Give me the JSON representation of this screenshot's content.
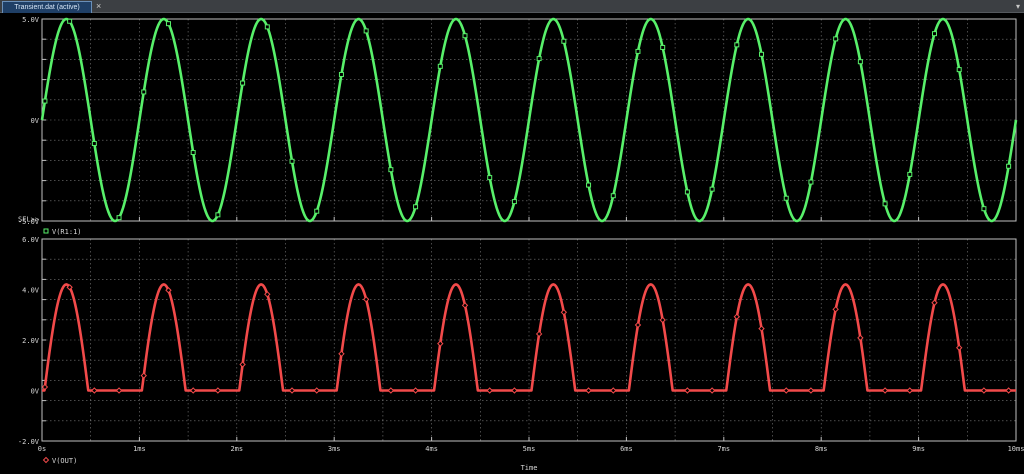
{
  "tab": {
    "label": "Transient.dat (active)",
    "close_glyph": "×",
    "menu_glyph": "▾"
  },
  "colors": {
    "plot_bg": "#000000",
    "grid": "#7a7a7a",
    "axis": "#bfbfbf",
    "series1": "#58f06a",
    "series2": "#f24a4a"
  },
  "x_axis": {
    "title": "Time",
    "ticks": [
      "0s",
      "1ms",
      "2ms",
      "3ms",
      "4ms",
      "5ms",
      "6ms",
      "7ms",
      "8ms",
      "9ms",
      "10ms"
    ]
  },
  "sel_marker": "SEL>>",
  "chart_data": [
    {
      "type": "line",
      "series": [
        {
          "name": "V(R1:1)",
          "color": "#58f06a",
          "marker": "square",
          "amplitude": 5.0,
          "frequency_hz": 1000,
          "phase": 0
        }
      ],
      "y_ticks": [
        "5.0V",
        "0V",
        "-5.0V"
      ],
      "ylim": [
        -5.0,
        5.0
      ],
      "xlim_ms": [
        0,
        10
      ],
      "grid": true
    },
    {
      "type": "line",
      "series": [
        {
          "name": "V(OUT)",
          "color": "#f24a4a",
          "marker": "diamond",
          "amplitude": 5.0,
          "diode_drop": 0.8,
          "peak": 4.2,
          "frequency_hz": 1000
        }
      ],
      "y_ticks": [
        "6.0V",
        "4.0V",
        "2.0V",
        "0V",
        "-2.0V"
      ],
      "ylim": [
        -2.0,
        6.0
      ],
      "xlim_ms": [
        0,
        10
      ],
      "grid": true
    }
  ]
}
